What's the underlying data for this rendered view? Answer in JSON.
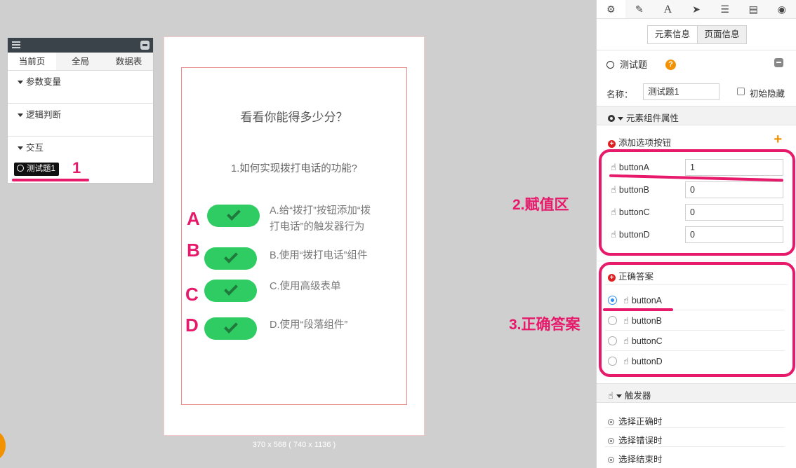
{
  "left_panel": {
    "tabs": [
      "当前页",
      "全局",
      "数据表"
    ],
    "sections": [
      "参数变量",
      "逻辑判断",
      "交互"
    ],
    "item_label": "测试题1",
    "annotation": "1"
  },
  "canvas": {
    "title": "看看你能得多少分？",
    "question": "1.如何实现拨打电话的功能?",
    "options": [
      {
        "letter": "A",
        "line1": "A.给“拨打”按钮添加“拨",
        "line2": "打电话”的触发器行为"
      },
      {
        "letter": "B",
        "line1": "B.使用“拨打电话”组件",
        "line2": ""
      },
      {
        "letter": "C",
        "line1": "C.使用高级表单",
        "line2": ""
      },
      {
        "letter": "D",
        "line1": "D.使用“段落组件”",
        "line2": ""
      }
    ],
    "size_label": "370 x 568 ( 740 x 1136 )",
    "button_color": "#2ecc63"
  },
  "annotations": {
    "assign_area": "2.赋值区",
    "correct_answer": "3.正确答案",
    "color": "#e6196b"
  },
  "right_panel": {
    "toolbar_icons": [
      "gear-icon",
      "pencil-icon",
      "font-icon",
      "send-icon",
      "list-icon",
      "file-icon",
      "database-icon"
    ],
    "info_tabs": [
      "元素信息",
      "页面信息"
    ],
    "component_title": "测试题",
    "help": "?",
    "name_label": "名称：",
    "name_value": "测试题1",
    "hidden_label": "初始隐藏",
    "props_header": "元素组件属性",
    "add_option_label": "添加选项按钮",
    "assign_rows": [
      {
        "name": "buttonA",
        "value": "1"
      },
      {
        "name": "buttonB",
        "value": "0"
      },
      {
        "name": "buttonC",
        "value": "0"
      },
      {
        "name": "buttonD",
        "value": "0"
      }
    ],
    "correct_header": "正确答案",
    "correct_options": [
      "buttonA",
      "buttonB",
      "buttonC",
      "buttonD"
    ],
    "correct_selected": "buttonA",
    "trigger_header": "触发器",
    "triggers": [
      "选择正确时",
      "选择错误时",
      "选择结束时"
    ]
  }
}
